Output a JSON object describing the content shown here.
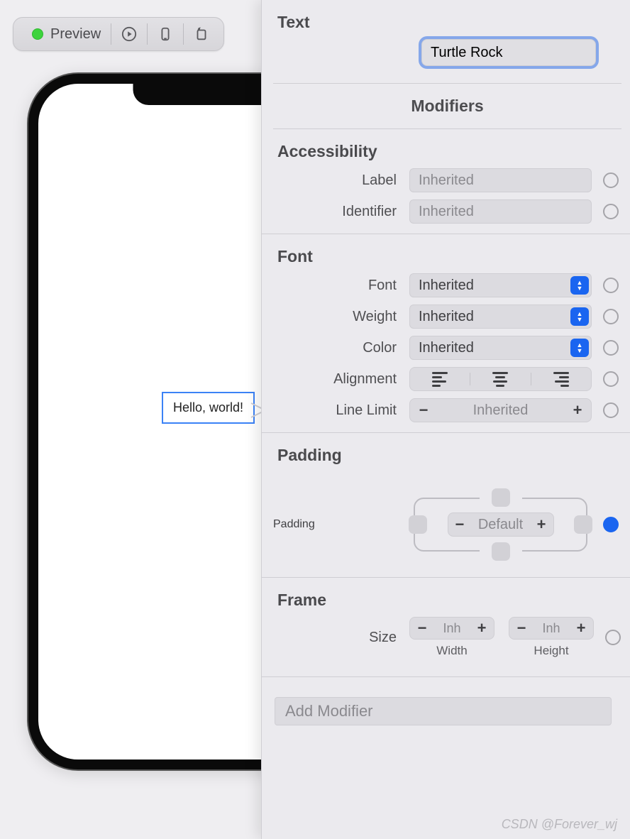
{
  "toolbar": {
    "preview_label": "Preview"
  },
  "canvas": {
    "selected_text": "Hello, world!"
  },
  "inspector": {
    "text_section": {
      "title": "Text",
      "value": "Turtle Rock"
    },
    "modifiers_header": "Modifiers",
    "accessibility": {
      "title": "Accessibility",
      "label_caption": "Label",
      "label_placeholder": "Inherited",
      "identifier_caption": "Identifier",
      "identifier_placeholder": "Inherited"
    },
    "font": {
      "title": "Font",
      "font_caption": "Font",
      "font_value": "Inherited",
      "weight_caption": "Weight",
      "weight_value": "Inherited",
      "color_caption": "Color",
      "color_value": "Inherited",
      "alignment_caption": "Alignment",
      "linelimit_caption": "Line Limit",
      "linelimit_value": "Inherited"
    },
    "padding": {
      "title": "Padding",
      "caption": "Padding",
      "center_value": "Default"
    },
    "frame": {
      "title": "Frame",
      "size_caption": "Size",
      "width_value": "Inh",
      "width_caption": "Width",
      "height_value": "Inh",
      "height_caption": "Height"
    },
    "add_modifier_placeholder": "Add Modifier"
  },
  "watermark": "CSDN @Forever_wj"
}
